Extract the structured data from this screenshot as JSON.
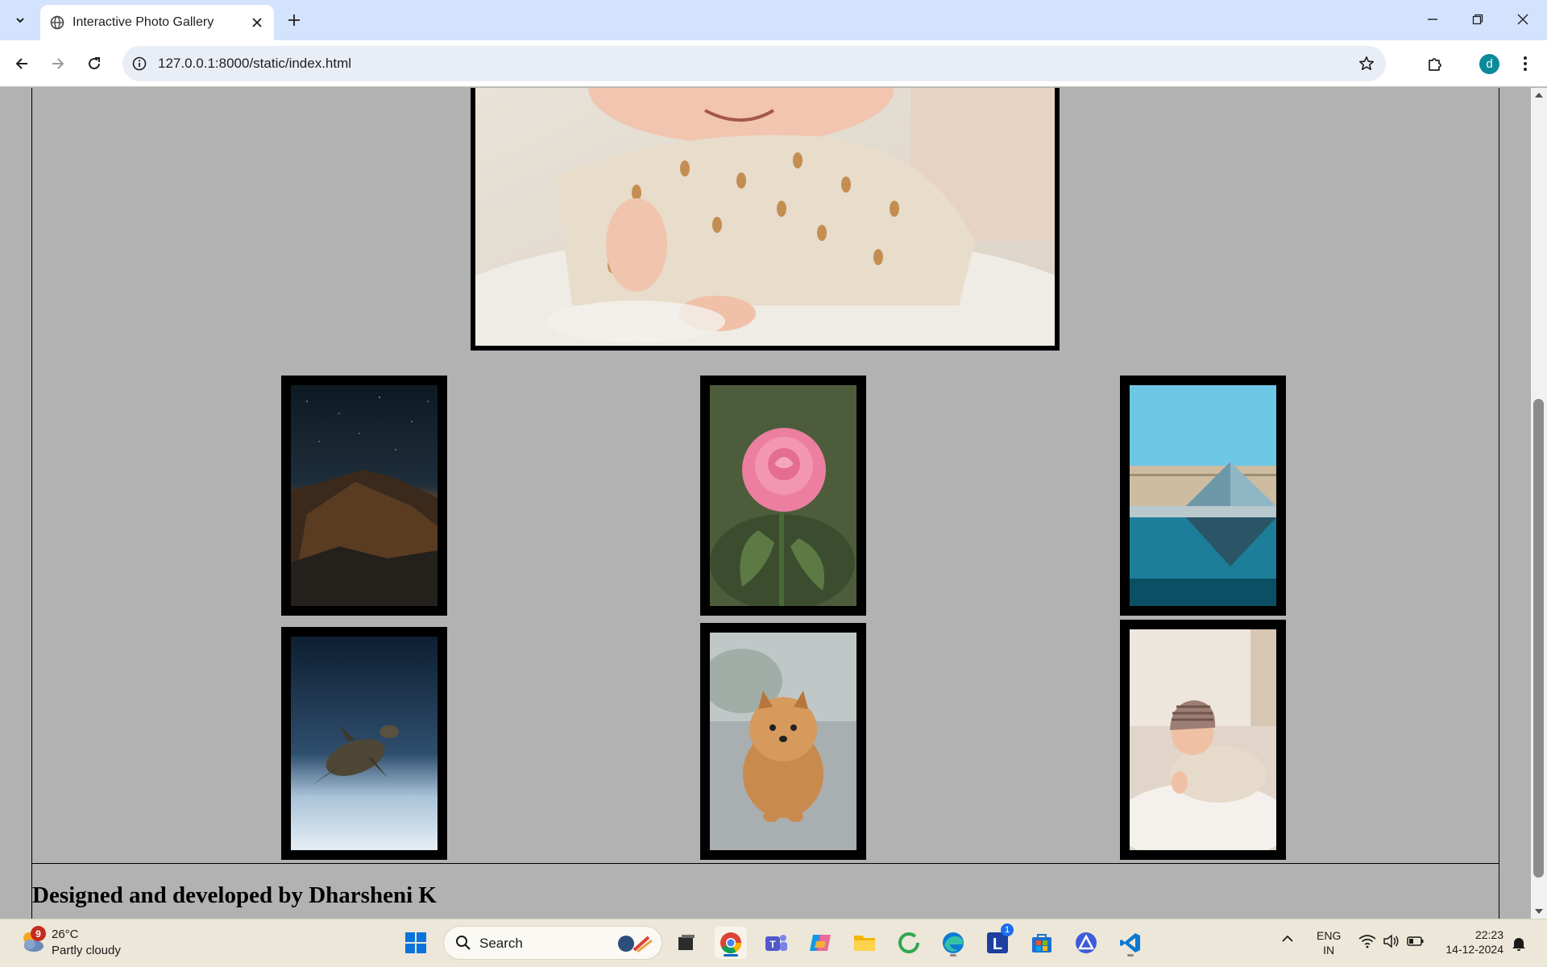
{
  "browser": {
    "tab_title": "Interactive Photo Gallery",
    "url": "127.0.0.1:8000/static/index.html",
    "profile_initial": "d"
  },
  "page": {
    "footer": "Designed and developed by Dharsheni K",
    "hero": {
      "subject": "smiling baby on fur rug"
    },
    "thumbnails": [
      {
        "subject": "mountain under starry night sky"
      },
      {
        "subject": "pink rose"
      },
      {
        "subject": "Louvre glass pyramid"
      },
      {
        "subject": "sea turtle underwater"
      },
      {
        "subject": "pomeranian puppy"
      },
      {
        "subject": "baby in knit hat"
      }
    ]
  },
  "taskbar": {
    "weather_temp": "26°C",
    "weather_desc": "Partly cloudy",
    "weather_badge": "9",
    "search_label": "Search",
    "l_badge": "1",
    "lang_line1": "ENG",
    "lang_line2": "IN",
    "time": "22:23",
    "date": "14-12-2024"
  },
  "colors": {
    "page_bg": "#b2b2b2",
    "frame": "#000000",
    "tabbar": "#d3e3fd",
    "taskbar": "#ece7d8"
  }
}
